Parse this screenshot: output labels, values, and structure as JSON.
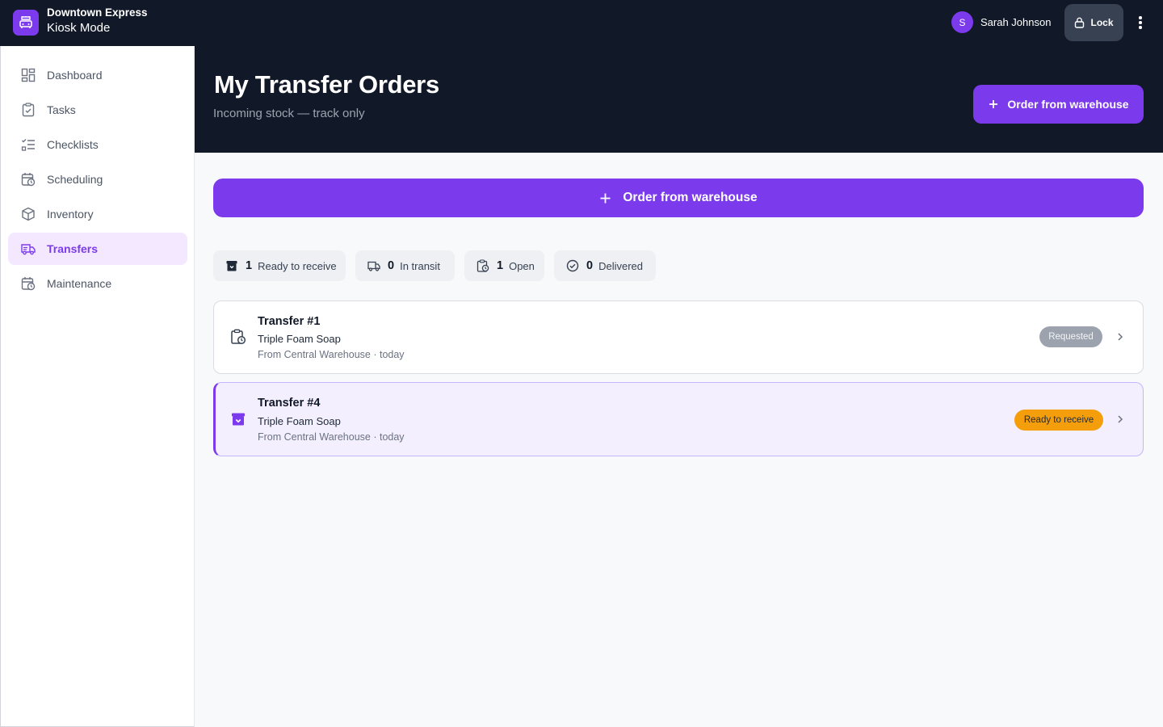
{
  "app": {
    "store_name": "Downtown Express",
    "mode": "Kiosk Mode",
    "brand_color": "#7c3aed"
  },
  "user": {
    "initial": "S",
    "name": "Sarah Johnson"
  },
  "topbar": {
    "lock_label": "Lock"
  },
  "sidebar": {
    "items": [
      {
        "label": "Dashboard",
        "icon": "dashboard-icon"
      },
      {
        "label": "Tasks",
        "icon": "clipboard-check-icon"
      },
      {
        "label": "Checklists",
        "icon": "checklist-icon"
      },
      {
        "label": "Scheduling",
        "icon": "calendar-clock-icon"
      },
      {
        "label": "Inventory",
        "icon": "box-icon"
      },
      {
        "label": "Transfers",
        "icon": "truck-icon",
        "active": true
      },
      {
        "label": "Maintenance",
        "icon": "calendar-clock-icon"
      }
    ]
  },
  "header": {
    "title": "My Transfer Orders",
    "subtitle": "Incoming stock — track only",
    "order_button": "Order from warehouse"
  },
  "main": {
    "order_button": "Order from warehouse",
    "stats": [
      {
        "count": "1",
        "label": "Ready to receive",
        "icon": "archive-box-icon"
      },
      {
        "count": "0",
        "label": "In transit",
        "icon": "truck-icon"
      },
      {
        "count": "1",
        "label": "Open",
        "icon": "clipboard-clock-icon"
      },
      {
        "count": "0",
        "label": "Delivered",
        "icon": "check-circle-icon"
      }
    ],
    "transfers": [
      {
        "title": "Transfer #1",
        "product": "Triple Foam Soap",
        "source": "From Central Warehouse · today",
        "status": "Requested",
        "status_color": "#9ca3af"
      },
      {
        "title": "Transfer #4",
        "product": "Triple Foam Soap",
        "source": "From Central Warehouse · today",
        "status": "Ready to receive",
        "status_color": "#f59e0b"
      }
    ]
  }
}
